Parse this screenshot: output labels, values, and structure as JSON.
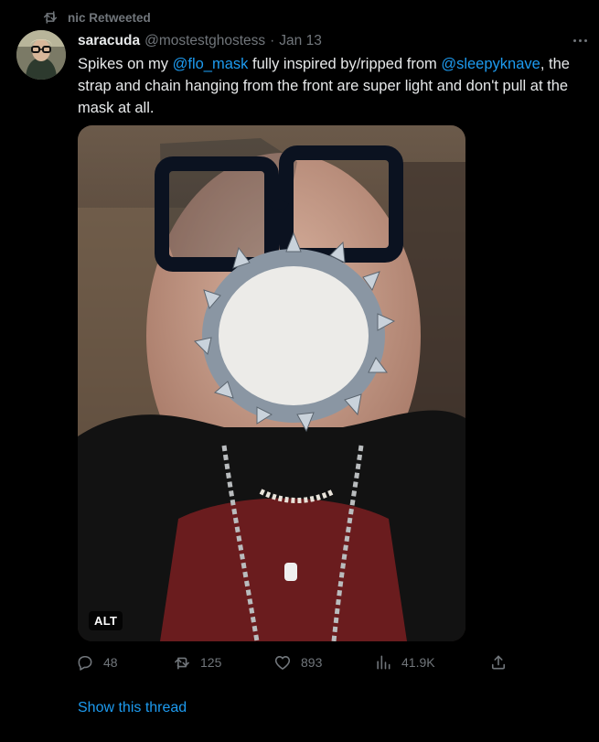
{
  "retweet": {
    "label": "nic Retweeted",
    "icon": "retweet-icon"
  },
  "tweet": {
    "display_name": "saracuda",
    "handle": "@mostestghostess",
    "separator": "·",
    "date": "Jan 13",
    "text": {
      "p1": "Spikes on my ",
      "mention1": "@flo_mask",
      "p2": " fully inspired by/ripped from ",
      "mention2": "@sleepyknave",
      "p3": ", the strap and chain hanging from the front are super light and don't pull at the mask at all."
    },
    "media": {
      "alt_badge": "ALT"
    },
    "actions": {
      "replies": "48",
      "retweets": "125",
      "likes": "893",
      "views": "41.9K"
    },
    "show_thread": "Show this thread"
  },
  "colors": {
    "background": "#000000",
    "link": "#1d9bf0",
    "muted": "#71767b",
    "text": "#e7e9ea"
  }
}
